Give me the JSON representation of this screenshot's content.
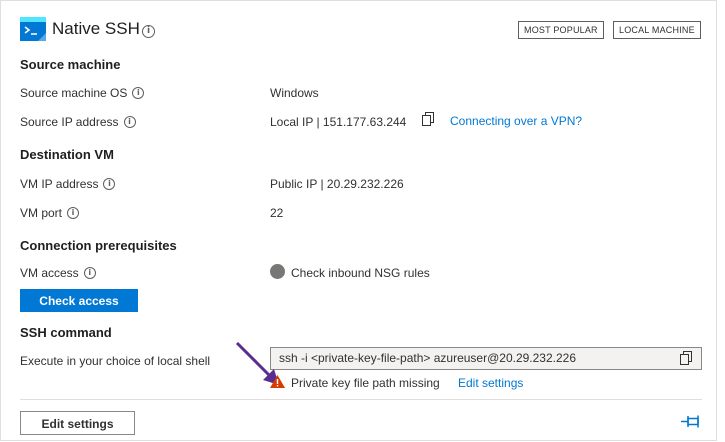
{
  "header": {
    "title": "Native SSH",
    "icon": "terminal-icon",
    "badges": [
      "MOST POPULAR",
      "LOCAL MACHINE"
    ]
  },
  "source_machine": {
    "heading": "Source machine",
    "os_label": "Source machine OS",
    "os_value": "Windows",
    "ip_label": "Source IP address",
    "ip_value": "Local IP | 151.177.63.244",
    "vpn_link": "Connecting over a VPN?"
  },
  "destination_vm": {
    "heading": "Destination VM",
    "ip_label": "VM IP address",
    "ip_value": "Public IP | 20.29.232.226",
    "port_label": "VM port",
    "port_value": "22"
  },
  "prerequisites": {
    "heading": "Connection prerequisites",
    "access_label": "VM access",
    "access_status": "Check inbound NSG rules",
    "check_button": "Check access"
  },
  "ssh_command": {
    "heading": "SSH command",
    "shell_label": "Execute in your choice of local shell",
    "command": "ssh -i <private-key-file-path> azureuser@20.29.232.226",
    "warning": "Private key file path missing",
    "edit_link": "Edit settings"
  },
  "footer": {
    "edit_button": "Edit settings"
  },
  "colors": {
    "accent": "#0078d4",
    "warning": "#d83b01",
    "annotation_arrow": "#5c2d91",
    "status_gray": "#797775"
  }
}
